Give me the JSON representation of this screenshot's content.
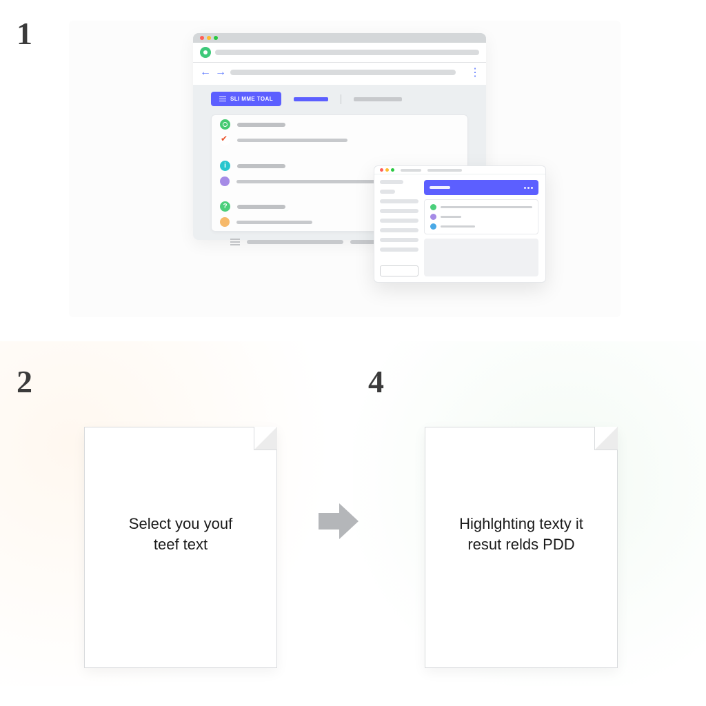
{
  "steps": {
    "one": "1",
    "two": "2",
    "four": "4"
  },
  "browser": {
    "button_label": "SLI MME TOAL"
  },
  "docs": {
    "left_line1": "Select you youf",
    "left_line2": "teef text",
    "right_line1": "Highlghting texty it",
    "right_line2": "resut relds PDD"
  }
}
